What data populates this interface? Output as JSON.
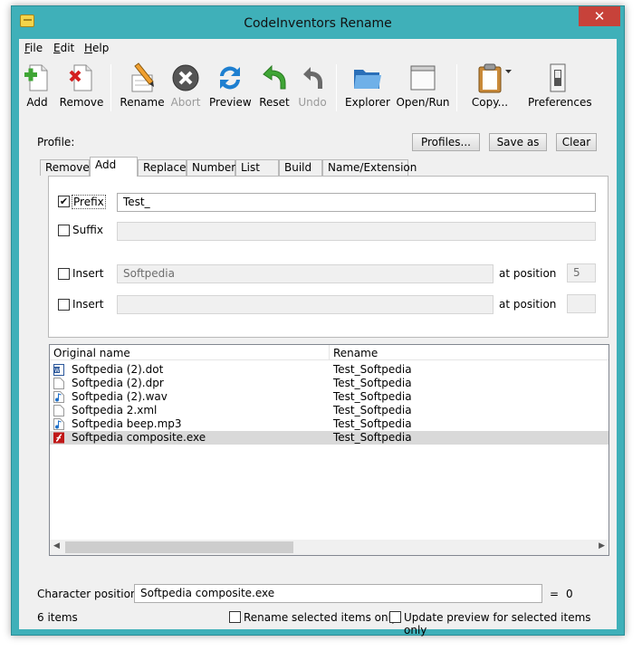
{
  "window": {
    "title": "CodeInventors Rename",
    "close_glyph": "✕"
  },
  "menu": [
    {
      "prefix": "",
      "accel": "F",
      "rest": "ile"
    },
    {
      "prefix": "",
      "accel": "E",
      "rest": "dit"
    },
    {
      "prefix": "",
      "accel": "H",
      "rest": "elp"
    }
  ],
  "toolbar": {
    "add": "Add",
    "remove": "Remove",
    "rename": "Rename",
    "abort": "Abort",
    "preview": "Preview",
    "reset": "Reset",
    "undo": "Undo",
    "explorer": "Explorer",
    "open_run": "Open/Run",
    "copy": "Copy...",
    "preferences": "Preferences"
  },
  "profile": {
    "label": "Profile:",
    "profiles_button": "Profiles...",
    "save_as_button": "Save as",
    "clear_button": "Clear"
  },
  "tabs": [
    "Remove",
    "Add",
    "Replace",
    "Number",
    "List",
    "Build",
    "Name/Extension"
  ],
  "active_tab": "Add",
  "add_panel": {
    "prefix": {
      "label": "Prefix",
      "checked": true,
      "check_glyph": "✔",
      "value": "Test_"
    },
    "suffix": {
      "label": "Suffix",
      "checked": false,
      "value": ""
    },
    "insert1": {
      "label": "Insert",
      "checked": false,
      "value": "Softpedia",
      "position_label": "at position",
      "position": "5"
    },
    "insert2": {
      "label": "Insert",
      "checked": false,
      "value": "",
      "position_label": "at position",
      "position": ""
    }
  },
  "file_list": {
    "columns": {
      "original": "Original name",
      "rename": "Rename"
    },
    "rows": [
      {
        "name": "Softpedia (2).dot",
        "rename": "Test_Softpedia",
        "icon": "word-doc-icon",
        "selected": false
      },
      {
        "name": "Softpedia (2).dpr",
        "rename": "Test_Softpedia",
        "icon": "blank-file-icon",
        "selected": false
      },
      {
        "name": "Softpedia (2).wav",
        "rename": "Test_Softpedia",
        "icon": "audio-file-icon",
        "selected": false
      },
      {
        "name": "Softpedia 2.xml",
        "rename": "Test_Softpedia",
        "icon": "blank-file-icon",
        "selected": false
      },
      {
        "name": "Softpedia beep.mp3",
        "rename": "Test_Softpedia",
        "icon": "audio-file-icon",
        "selected": false
      },
      {
        "name": "Softpedia composite.exe",
        "rename": "Test_Softpedia",
        "icon": "flash-exe-icon",
        "selected": true
      }
    ],
    "scroll_left": "◀",
    "scroll_right": "▶"
  },
  "char_position": {
    "label": "Character position",
    "value": "Softpedia composite.exe",
    "equals": "=",
    "result": "0"
  },
  "status": {
    "item_count": "6 items",
    "rename_selected_only": "Rename selected items only",
    "update_preview_selected": "Update preview for selected items only"
  },
  "colors": {
    "titlebar": "#3fb0b9",
    "close": "#c7423a",
    "selected_row": "#d9d9d9"
  }
}
